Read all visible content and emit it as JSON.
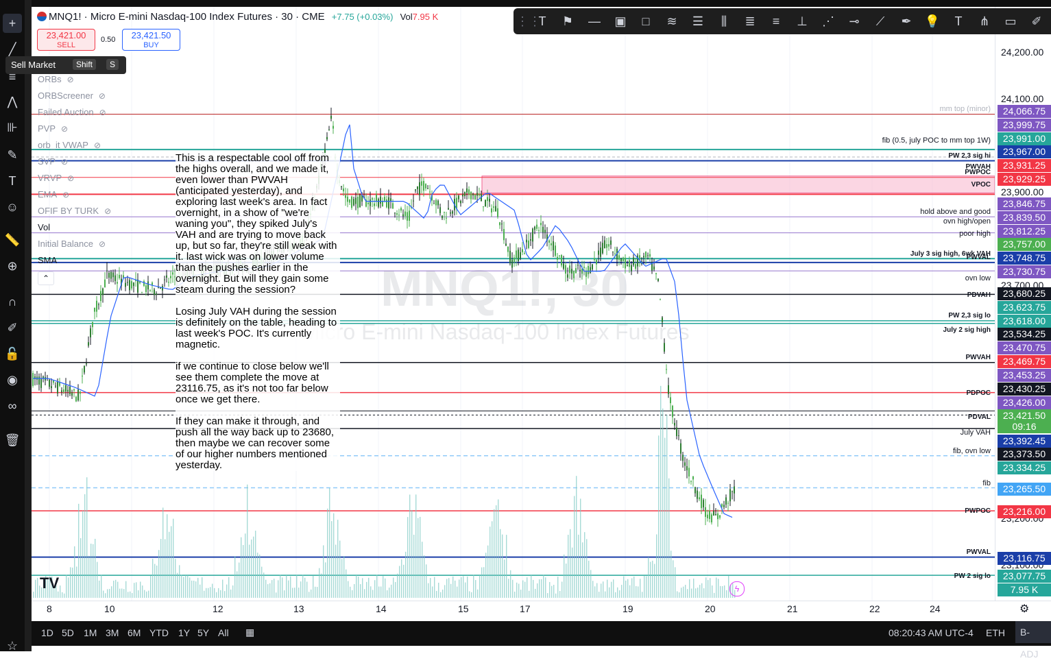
{
  "header": {
    "symbol_title": "MNQ1! · Micro E-mini Nasdaq-100 Index Futures · 30 · CME",
    "change": "+7.75 (+0.03%)",
    "vol_label": "Vol",
    "vol_value": "7.95 K",
    "sell_price": "23,421.00",
    "sell_label": "SELL",
    "spread": "0.50",
    "buy_price": "23,421.50",
    "buy_label": "BUY"
  },
  "tooltip": {
    "label": "Sell Market",
    "shift_key": "Shift",
    "s_key": "S"
  },
  "indicators": [
    "ORBs",
    "ORBScreener",
    "Failed Auction",
    "PVP",
    "orb_it VWAP",
    "SVP",
    "VRVP",
    "EMA",
    "OFIF BY TURK",
    "Vol",
    "Initial Balance",
    "SMA"
  ],
  "watermark": {
    "symbol": "MNQ1!, 30",
    "name": "Micro E-mini Nasdaq-100 Index Futures"
  },
  "note_text": "This is a respectable cool off from the highs overall, and we made it, even lower than PWVAH (anticipated yesterday), and exploring last week's area. In fact overnight, in a show of \"we're waning you\", they spiked July's VAH and are trying to move back  up, but so far, they're still weak with it. last wick was on lower volume than the pushes earlier in the overnight. But will they gain some steam during the session?\n\nLosing July VAH during the session is definitely on the table, heading to last week's POC. It's currently magnetic.\n\nif we continue to close below we'll see them complete the move at 23116.75, as it's not too far below once we get there.\n\nIf they can make it through, and push all the way back up to 23680, then maybe we can recover some of our higher numbers mentioned yesterday.",
  "level_labels": [
    {
      "text": "mm top (minor)",
      "y": 24066.75
    },
    {
      "text": "fib (0.5, july POC  to mm top 1W)",
      "y": 23980
    },
    {
      "text": "PW 2,3 sig hi",
      "y": 23945
    },
    {
      "text": "PWVAH",
      "y": 23912
    },
    {
      "text": "PWPOC",
      "y": 23900
    },
    {
      "text": "VPOC",
      "y": 23886
    },
    {
      "text": "hold above and good",
      "y": 23835
    },
    {
      "text": "ovn high/open",
      "y": 23818
    },
    {
      "text": "poor high",
      "y": 23790
    },
    {
      "text": "July 3 sig high, 6wk VAH",
      "y": 23738
    },
    {
      "text": "PWVAL",
      "y": 23730
    },
    {
      "text": "ovn low",
      "y": 23702
    },
    {
      "text": "PDVAH",
      "y": 23663
    },
    {
      "text": "PW 2,3 sig lo",
      "y": 23615
    },
    {
      "text": "July 2 sig high",
      "y": 23572
    },
    {
      "text": "PWVAH",
      "y": 23490
    },
    {
      "text": "PDPOC",
      "y": 23420
    },
    {
      "text": "PDVAL",
      "y": 23383
    },
    {
      "text": "July VAH",
      "y": 23370
    },
    {
      "text": "fib, ovn low",
      "y": 23340
    },
    {
      "text": "fib",
      "y": 23275
    },
    {
      "text": "PWPOC",
      "y": 23216
    },
    {
      "text": "PWVAL",
      "y": 23116.75
    },
    {
      "text": "PW 2 sig lo",
      "y": 23077.75
    }
  ],
  "price_ticks": [
    "24,200.00",
    "24,100.00",
    "23,900.00",
    "23,700.00",
    "23,200.00",
    "23,100.00"
  ],
  "price_tags": [
    {
      "text": "24,066.75",
      "color": "#7e57c2"
    },
    {
      "text": "23,999.75",
      "color": "#7e57c2"
    },
    {
      "text": "23,991.00",
      "color": "#26a69a"
    },
    {
      "text": "23,967.00",
      "color": "#1a3ea8"
    },
    {
      "text": "23,931.25",
      "color": "#f23645"
    },
    {
      "text": "23,929.25",
      "color": "#f23645"
    },
    {
      "text": "23,846.75",
      "color": "#7e57c2"
    },
    {
      "text": "23,839.50",
      "color": "#7e57c2"
    },
    {
      "text": "23,812.25",
      "color": "#7e57c2"
    },
    {
      "text": "23,757.00",
      "color": "#4caf50"
    },
    {
      "text": "23,748.75",
      "color": "#1a3ea8"
    },
    {
      "text": "23,730.75",
      "color": "#7e57c2"
    },
    {
      "text": "23,680.25",
      "color": "#131722"
    },
    {
      "text": "23,623.75",
      "color": "#26a69a"
    },
    {
      "text": "23,618.00",
      "color": "#26a69a"
    },
    {
      "text": "23,534.25",
      "color": "#131722"
    },
    {
      "text": "23,470.75",
      "color": "#7e57c2"
    },
    {
      "text": "23,469.75",
      "color": "#f23645"
    },
    {
      "text": "23,453.25",
      "color": "#7e57c2"
    },
    {
      "text": "23,430.25",
      "color": "#131722"
    },
    {
      "text": "23,426.00",
      "color": "#7e57c2"
    },
    {
      "text": "23,421.50",
      "color": "#4caf50"
    },
    {
      "text": "09:16",
      "color": "#4caf50"
    },
    {
      "text": "23,392.45",
      "color": "#1a3ea8"
    },
    {
      "text": "23,373.50",
      "color": "#131722"
    },
    {
      "text": "23,334.25",
      "color": "#26a69a"
    },
    {
      "text": "23,265.50",
      "color": "#42a5f5"
    },
    {
      "text": "23,216.00",
      "color": "#f23645"
    },
    {
      "text": "23,116.75",
      "color": "#1a3ea8"
    },
    {
      "text": "23,077.75",
      "color": "#26a69a"
    },
    {
      "text": "7.95 K",
      "color": "#26a69a"
    }
  ],
  "time_ticks": [
    "8",
    "10",
    "12",
    "13",
    "14",
    "15",
    "17",
    "19",
    "20",
    "21",
    "22",
    "24"
  ],
  "bottom_bar": {
    "ranges": [
      "1D",
      "5D",
      "1M",
      "3M",
      "6M",
      "YTD",
      "1Y",
      "5Y",
      "All"
    ],
    "clock": "08:20:43 AM UTC-4",
    "session": "ETH",
    "adj": "B-ADJ"
  },
  "chart_data": {
    "type": "candlestick",
    "title": "MNQ1! · Micro E-mini Nasdaq-100 Index Futures · 30 · CME",
    "x_ticks": [
      "8",
      "10",
      "12",
      "13",
      "14",
      "15",
      "17",
      "19",
      "20",
      "21",
      "22",
      "24"
    ],
    "last_price": 23421.5,
    "levels": [
      24066.75,
      23999.75,
      23991.0,
      23967.0,
      23931.25,
      23929.25,
      23846.75,
      23839.5,
      23812.25,
      23757.0,
      23748.75,
      23730.75,
      23680.25,
      23623.75,
      23618.0,
      23534.25,
      23470.75,
      23469.75,
      23453.25,
      23430.25,
      23426.0,
      23421.5,
      23392.45,
      23373.5,
      23334.25,
      23265.5,
      23216.0,
      23116.75,
      23077.75
    ]
  }
}
